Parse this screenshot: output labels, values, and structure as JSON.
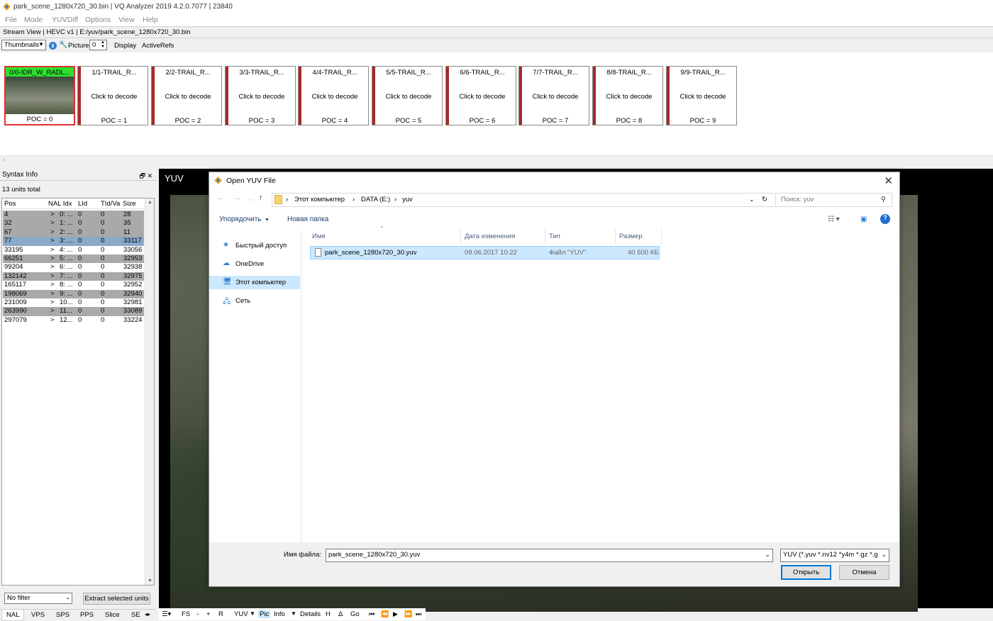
{
  "window": {
    "title": "park_scene_1280x720_30.bin | VQ Analyzer 2019 4.2.0.7077  | 23840",
    "accent": "#f5a623"
  },
  "menu": [
    "File",
    "Mode",
    "YUVDiff",
    "Options",
    "View",
    "Help"
  ],
  "stream_view": "Stream View  | HEVC v1 | E:/yuv/park_scene_1280x720_30.bin",
  "toolbar": {
    "view_mode": "Thumbnails",
    "picture_label": "Picture:",
    "picture_value": "0",
    "display": "Display",
    "active_refs": "ActiveRefs"
  },
  "thumbnails": [
    {
      "head": "0/0-IDR_W_RADL...",
      "poc": "POC = 0",
      "mid": ""
    },
    {
      "head": "1/1-TRAIL_R...",
      "mid": "Click to decode",
      "poc": "POC = 1"
    },
    {
      "head": "2/2-TRAIL_R...",
      "mid": "Click to decode",
      "poc": "POC = 2"
    },
    {
      "head": "3/3-TRAIL_R...",
      "mid": "Click to decode",
      "poc": "POC = 3"
    },
    {
      "head": "4/4-TRAIL_R...",
      "mid": "Click to decode",
      "poc": "POC = 4"
    },
    {
      "head": "5/5-TRAIL_R...",
      "mid": "Click to decode",
      "poc": "POC = 5"
    },
    {
      "head": "6/6-TRAIL_R...",
      "mid": "Click to decode",
      "poc": "POC = 6"
    },
    {
      "head": "7/7-TRAIL_R...",
      "mid": "Click to decode",
      "poc": "POC = 7"
    },
    {
      "head": "8/8-TRAIL_R...",
      "mid": "Click to decode",
      "poc": "POC = 8"
    },
    {
      "head": "9/9-TRAIL_R...",
      "mid": "Click to decode",
      "poc": "POC = 9"
    }
  ],
  "syntax": {
    "title": "Syntax Info",
    "panel_buttons": "🗗 ✕",
    "total": "13 units total",
    "columns": [
      "Pos",
      "NAL Idx",
      "LId",
      "TId/Va",
      "Size"
    ],
    "rows": [
      {
        "pos": "4",
        "nal": "0: ...",
        "lid": "0",
        "tid": "0",
        "size": "28",
        "style": "hl"
      },
      {
        "pos": "32",
        "nal": "1: ...",
        "lid": "0",
        "tid": "0",
        "size": "35",
        "style": "hl"
      },
      {
        "pos": "67",
        "nal": "2: ...",
        "lid": "0",
        "tid": "0",
        "size": "11",
        "style": "hl"
      },
      {
        "pos": "77",
        "nal": "3: ...",
        "lid": "0",
        "tid": "0",
        "size": "33117",
        "style": "sel"
      },
      {
        "pos": "33195",
        "nal": "4: ...",
        "lid": "0",
        "tid": "0",
        "size": "33056",
        "style": ""
      },
      {
        "pos": "66251",
        "nal": "5: ...",
        "lid": "0",
        "tid": "0",
        "size": "32953",
        "style": "hl"
      },
      {
        "pos": "99204",
        "nal": "6: ...",
        "lid": "0",
        "tid": "0",
        "size": "32938",
        "style": ""
      },
      {
        "pos": "132142",
        "nal": "7: ...",
        "lid": "0",
        "tid": "0",
        "size": "32975",
        "style": "hl"
      },
      {
        "pos": "165117",
        "nal": "8: ...",
        "lid": "0",
        "tid": "0",
        "size": "32952",
        "style": ""
      },
      {
        "pos": "198069",
        "nal": "9: ...",
        "lid": "0",
        "tid": "0",
        "size": "32940",
        "style": "hl"
      },
      {
        "pos": "231009",
        "nal": "10...",
        "lid": "0",
        "tid": "0",
        "size": "32981",
        "style": ""
      },
      {
        "pos": "263990",
        "nal": "11...",
        "lid": "0",
        "tid": "0",
        "size": "33089",
        "style": "hl"
      },
      {
        "pos": "297079",
        "nal": "12...",
        "lid": "0",
        "tid": "0",
        "size": "33224",
        "style": ""
      }
    ],
    "filter": "No filter",
    "extract": "Extract selected units",
    "tabs": [
      "NAL",
      "VPS",
      "SPS",
      "PPS",
      "Slice",
      "SE"
    ]
  },
  "yuv": {
    "label": "YUV",
    "toolbar": [
      "FS",
      "-",
      "+",
      "R",
      "YUV",
      "Pic",
      "Info",
      "Details",
      "H",
      "Δ",
      "Go"
    ]
  },
  "dialog": {
    "title": "Open YUV File",
    "address": [
      "Этот компьютер",
      "DATA (E:)",
      "yuv"
    ],
    "search_placeholder": "Поиск: yuv",
    "organize": "Упорядочить",
    "new_folder": "Новая папка",
    "nav": [
      {
        "label": "Быстрый доступ",
        "icon": "★"
      },
      {
        "label": "OneDrive",
        "icon": "☁"
      },
      {
        "label": "Этот компьютер",
        "icon": "🖥"
      },
      {
        "label": "Сеть",
        "icon": "🖧"
      }
    ],
    "columns": [
      "Имя",
      "Дата изменения",
      "Тип",
      "Размер"
    ],
    "file": {
      "name": "park_scene_1280x720_30.yuv",
      "date": "09.06.2017 10:22",
      "type": "Файл \"YUV\"",
      "size": "40 500 КБ"
    },
    "filename_label": "Имя файла:",
    "filename_value": "park_scene_1280x720_30.yuv",
    "filetype": "YUV (*.yuv *.nv12 *y4m *.gz *.g",
    "open_button": "Открыть",
    "cancel_button": "Отмена"
  }
}
